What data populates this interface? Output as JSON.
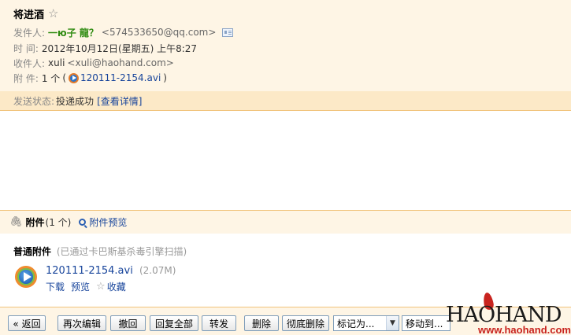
{
  "header": {
    "subject": "将进酒",
    "sender_label": "发件人:",
    "sender_name": "一ю子 龍？",
    "sender_email": "<574533650@qq.com>",
    "time_label": "时  间:",
    "time_value": "2012年10月12日(星期五) 上午8:27",
    "recipient_label": "收件人:",
    "recipient_name": "xuli",
    "recipient_email": "<xuli@haohand.com>",
    "attachment_label": "附  件:",
    "attachment_count": "1 个",
    "attachment_paren_open": "(",
    "attachment_paren_close": ")",
    "attachment_file": "120111-2154.avi"
  },
  "status": {
    "label": "发送状态:",
    "value": "投递成功",
    "details_link": "[查看详情]"
  },
  "attachments": {
    "title": "附件",
    "count": "(1 个)",
    "preview_link": "附件预览",
    "section_title": "普通附件",
    "section_note": "(已通过卡巴斯基杀毒引擎扫描)",
    "file_name": "120111-2154.avi",
    "file_size": "(2.07M)",
    "download": "下载",
    "preview": "预览",
    "favorite": "收藏"
  },
  "toolbar": {
    "back": "« 返回",
    "reedit": "再次编辑",
    "recall": "撤回",
    "reply_all": "回复全部",
    "forward": "转发",
    "delete": "删除",
    "delete_permanent": "彻底删除",
    "mark_as": "标记为...",
    "move_to": "移动到..."
  },
  "watermark": {
    "brand": "HAOHAND",
    "url": "www.haohand.com"
  },
  "colors": {
    "header_bg": "#fef5e5",
    "status_bg": "#fce9c7",
    "border": "#f1c37b",
    "link": "#17449b",
    "sender_green": "#2e8b10",
    "brand_red": "#c8231e"
  }
}
